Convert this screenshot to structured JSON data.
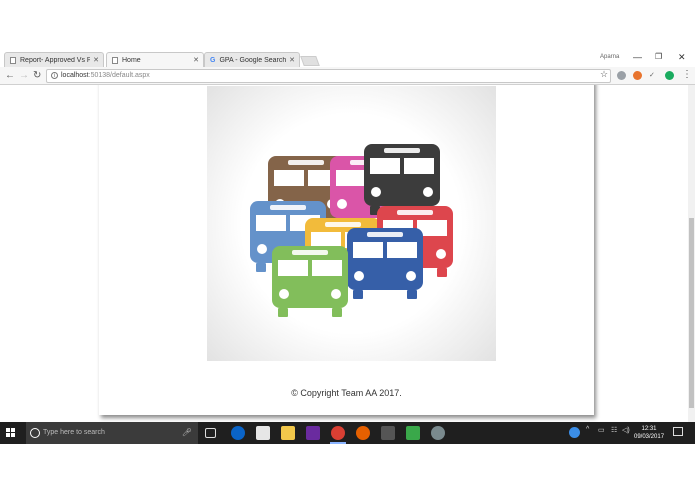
{
  "browser": {
    "tabs": [
      {
        "title": "Report- Approved Vs Pe",
        "icon": "page-icon",
        "active": false
      },
      {
        "title": "Home",
        "icon": "page-icon",
        "active": true
      },
      {
        "title": "GPA - Google Search",
        "icon": "google-icon",
        "active": false
      }
    ],
    "profile_name": "Aparna",
    "url_host": "localhost",
    "url_path": ":50138/default.aspx",
    "window_controls": [
      "minimize",
      "restore",
      "close"
    ]
  },
  "page": {
    "hero_image": "buses-illustration",
    "bus_colors": [
      "#6f4a2a",
      "#d4389a",
      "#1b1b1b",
      "#4a7fc1",
      "#f0b019",
      "#d8262f",
      "#13449a",
      "#6db33f"
    ],
    "copyright": "© Copyright Team AA 2017."
  },
  "taskbar": {
    "search_placeholder": "Type here to search",
    "time": "12:31",
    "date": "09/03/2017"
  }
}
